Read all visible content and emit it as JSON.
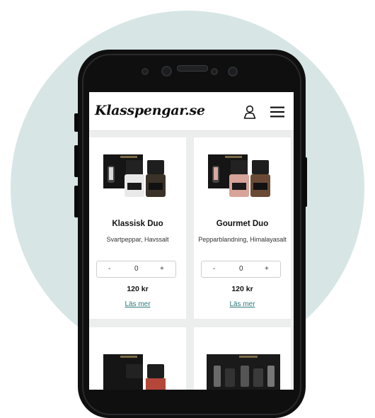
{
  "colors": {
    "background_circle": "#d7e5e5",
    "phone": "#0f0f10",
    "link": "#2f7a7a"
  },
  "header": {
    "logo": "Klasspengar.se",
    "icons": [
      "user-icon",
      "menu-icon"
    ]
  },
  "products": [
    {
      "name": "Klassisk Duo",
      "description": "Svartpeppar, Havssalt",
      "quantity": "0",
      "minus": "-",
      "plus": "+",
      "price": "120 kr",
      "link": "Läs mer"
    },
    {
      "name": "Gourmet Duo",
      "description": "Pepparblandning, Himalayasalt",
      "quantity": "0",
      "minus": "-",
      "plus": "+",
      "price": "120 kr",
      "link": "Läs mer"
    }
  ]
}
